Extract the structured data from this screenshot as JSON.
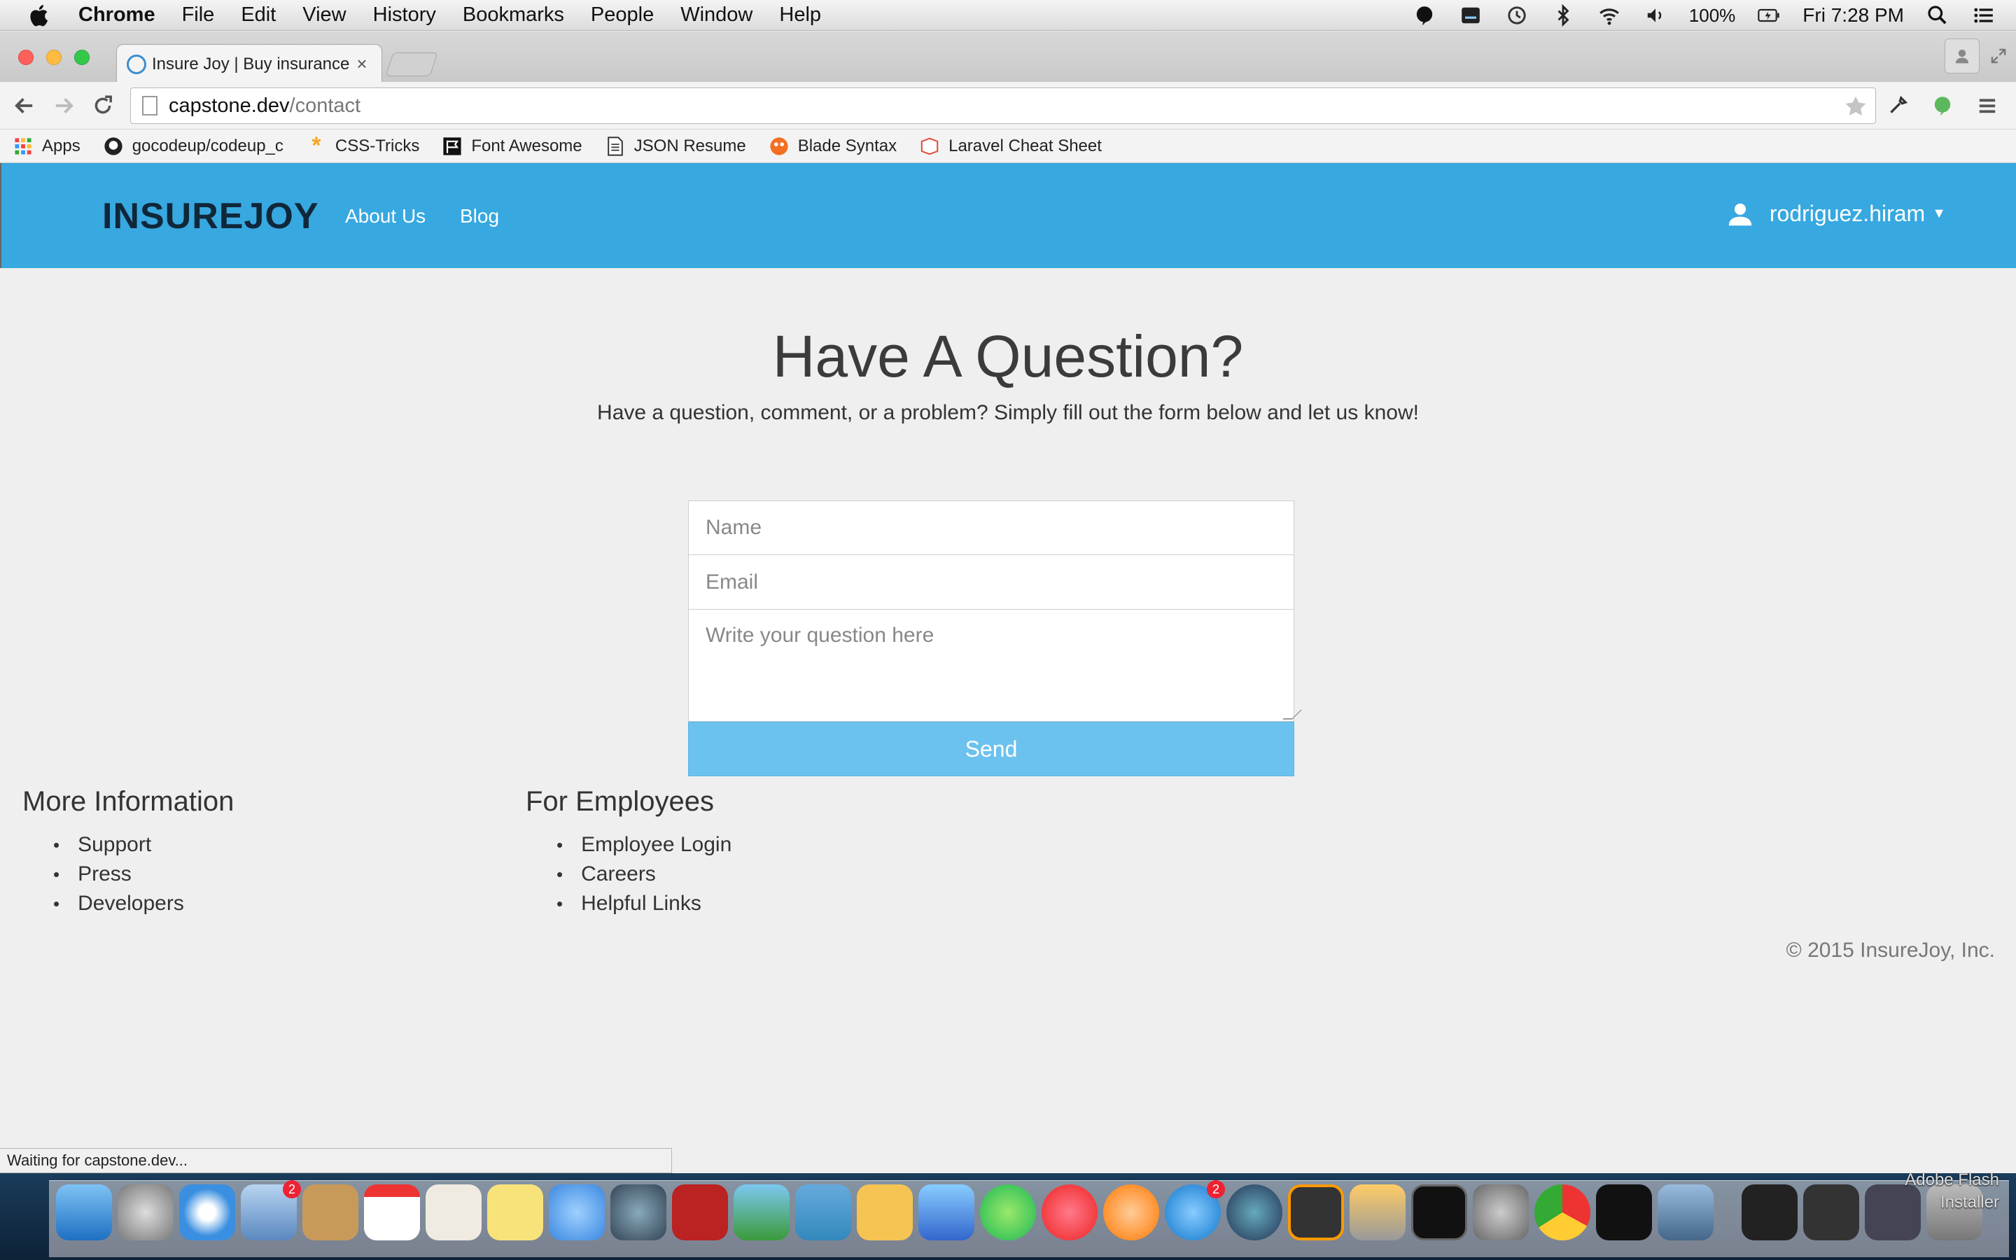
{
  "menubar": {
    "app": "Chrome",
    "items": [
      "File",
      "Edit",
      "View",
      "History",
      "Bookmarks",
      "People",
      "Window",
      "Help"
    ],
    "battery": "100%",
    "clock": "Fri 7:28 PM"
  },
  "browser": {
    "tab_title": "Insure Joy | Buy insurance",
    "url_host": "capstone.dev",
    "url_path": "/contact",
    "bookmarks": [
      "Apps",
      "gocodeup/codeup_c",
      "CSS-Tricks",
      "Font Awesome",
      "JSON Resume",
      "Blade Syntax",
      "Laravel Cheat Sheet"
    ],
    "status": "Waiting for capstone.dev..."
  },
  "site": {
    "brand": "INSUREJOY",
    "nav": [
      "About Us",
      "Blog"
    ],
    "user": "rodriguez.hiram",
    "accent": "#37a8e0"
  },
  "contact": {
    "heading": "Have A Question?",
    "subheading": "Have a question, comment, or a problem? Simply fill out the form below and let us know!",
    "name_placeholder": "Name",
    "email_placeholder": "Email",
    "question_placeholder": "Write your question here",
    "send_label": "Send"
  },
  "footer": {
    "col1": {
      "title": "More Information",
      "links": [
        "Support",
        "Press",
        "Developers"
      ]
    },
    "col2": {
      "title": "For Employees",
      "links": [
        "Employee Login",
        "Careers",
        "Helpful Links"
      ]
    },
    "copyright": "© 2015 InsureJoy, Inc."
  },
  "dock": {
    "flash_label_1": "Adobe Flash",
    "flash_label_2": "Installer"
  }
}
